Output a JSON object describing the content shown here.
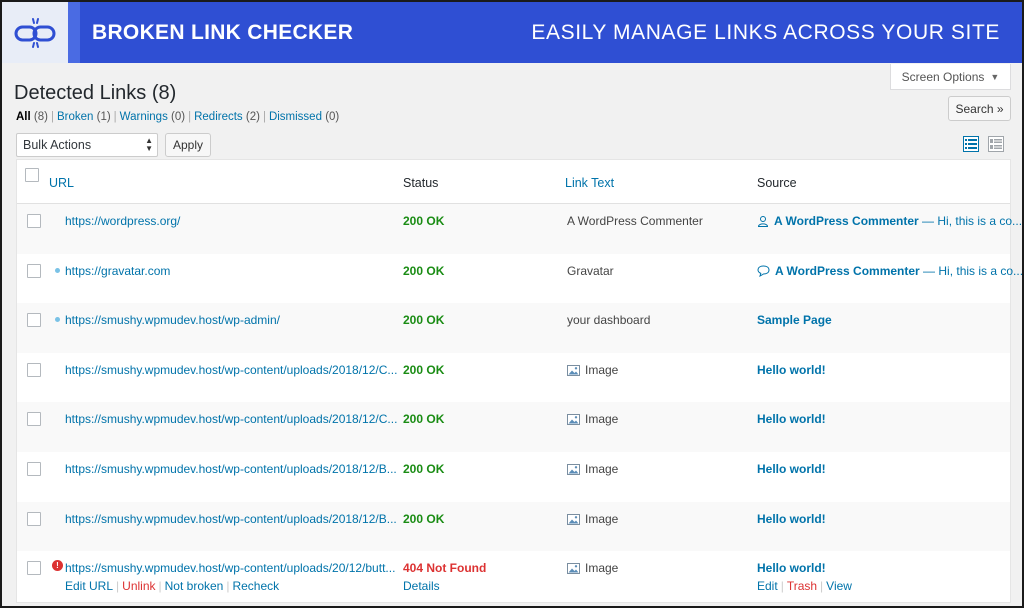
{
  "banner": {
    "title": "BROKEN LINK CHECKER",
    "tagline": "EASILY MANAGE LINKS ACROSS YOUR SITE"
  },
  "screen_options": {
    "label": "Screen Options"
  },
  "page": {
    "title": "Detected Links (8)"
  },
  "search": {
    "label": "Search »"
  },
  "filters": {
    "all": {
      "label": "All",
      "count": "(8)"
    },
    "broken": {
      "label": "Broken",
      "count": "(1)"
    },
    "warnings": {
      "label": "Warnings",
      "count": "(0)"
    },
    "redirects": {
      "label": "Redirects",
      "count": "(2)"
    },
    "dismissed": {
      "label": "Dismissed",
      "count": "(0)"
    }
  },
  "bulk": {
    "selected": "Bulk Actions",
    "apply_label": "Apply"
  },
  "table": {
    "columns": {
      "url": "URL",
      "status": "Status",
      "link_text": "Link Text",
      "source": "Source"
    },
    "rows": [
      {
        "url": "https://wordpress.org/",
        "status": "200 OK",
        "link_text": "A WordPress Commenter",
        "source_title": "A WordPress Commenter",
        "source_excerpt": " — Hi, this is a co..."
      },
      {
        "url": "https://gravatar.com",
        "status": "200 OK",
        "link_text": "Gravatar",
        "source_title": "A WordPress Commenter",
        "source_excerpt": " — Hi, this is a co..."
      },
      {
        "url": "https://smushy.wpmudev.host/wp-admin/",
        "status": "200 OK",
        "link_text": "your dashboard",
        "source_title": "Sample Page",
        "source_excerpt": ""
      },
      {
        "url": "https://smushy.wpmudev.host/wp-content/uploads/2018/12/C...",
        "status": "200 OK",
        "link_text": "Image",
        "source_title": "Hello world!",
        "source_excerpt": ""
      },
      {
        "url": "https://smushy.wpmudev.host/wp-content/uploads/2018/12/C...",
        "status": "200 OK",
        "link_text": "Image",
        "source_title": "Hello world!",
        "source_excerpt": ""
      },
      {
        "url": "https://smushy.wpmudev.host/wp-content/uploads/2018/12/B...",
        "status": "200 OK",
        "link_text": "Image",
        "source_title": "Hello world!",
        "source_excerpt": ""
      },
      {
        "url": "https://smushy.wpmudev.host/wp-content/uploads/2018/12/B...",
        "status": "200 OK",
        "link_text": "Image",
        "source_title": "Hello world!",
        "source_excerpt": ""
      },
      {
        "url": "https://smushy.wpmudev.host/wp-content/uploads/20/12/butt...",
        "status": "404 Not Found",
        "link_text": "Image",
        "source_title": "Hello world!",
        "source_excerpt": ""
      }
    ],
    "row_actions": {
      "edit_url": "Edit URL",
      "unlink": "Unlink",
      "not_broken": "Not broken",
      "recheck": "Recheck",
      "details": "Details",
      "edit": "Edit",
      "trash": "Trash",
      "view": "View"
    }
  },
  "colors": {
    "banner": "#2f4fd3",
    "link": "#0073aa",
    "ok": "#1a8c14",
    "error": "#dc3232"
  }
}
